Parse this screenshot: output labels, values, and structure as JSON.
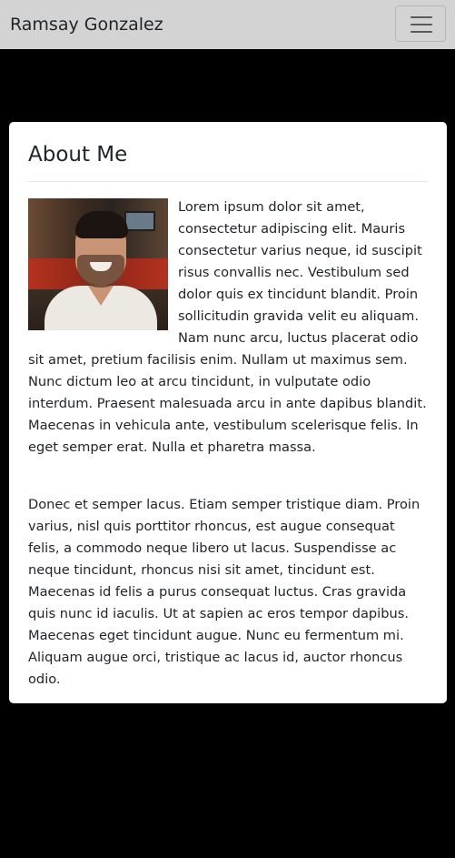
{
  "navbar": {
    "brand": "Ramsay Gonzalez",
    "toggle_icon": "hamburger-menu-icon"
  },
  "about": {
    "title": "About Me",
    "photo_alt": "Profile photo of a smiling man",
    "paragraph1": "Lorem ipsum dolor sit amet, consectetur adipiscing elit. Mauris consectetur varius neque, id suscipit risus convallis nec. Vestibulum sed dolor quis ex tincidunt blandit. Proin sollicitudin gravida velit eu aliquam. Nam nunc arcu, luctus placerat odio sit amet, pretium facilisis enim. Nullam ut maximus sem. Nunc dictum leo at arcu tincidunt, in vulputate odio interdum. Praesent malesuada arcu in ante dapibus blandit. Maecenas in vehicula ante, vestibulum scelerisque felis. In eget semper erat. Nulla et pharetra massa.",
    "paragraph2": "Donec et semper lacus. Etiam semper tristique diam. Proin varius, nisl quis porttitor rhoncus, est augue consequat felis, a commodo neque libero ut lacus. Suspendisse ac neque tincidunt, rhoncus nisi sit amet, tincidunt est. Maecenas id felis a purus consequat luctus. Cras gravida quis nunc id iaculis. Ut at sapien ac eros tempor dapibus. Maecenas eget tincidunt augue. Nunc eu fermentum mi. Aliquam augue orci, tristique ac lacus id, auctor rhoncus odio."
  },
  "colors": {
    "navbar_bg": "#d3d3d3",
    "page_bg": "#000000",
    "card_bg": "#ffffff",
    "text": "#212529"
  }
}
